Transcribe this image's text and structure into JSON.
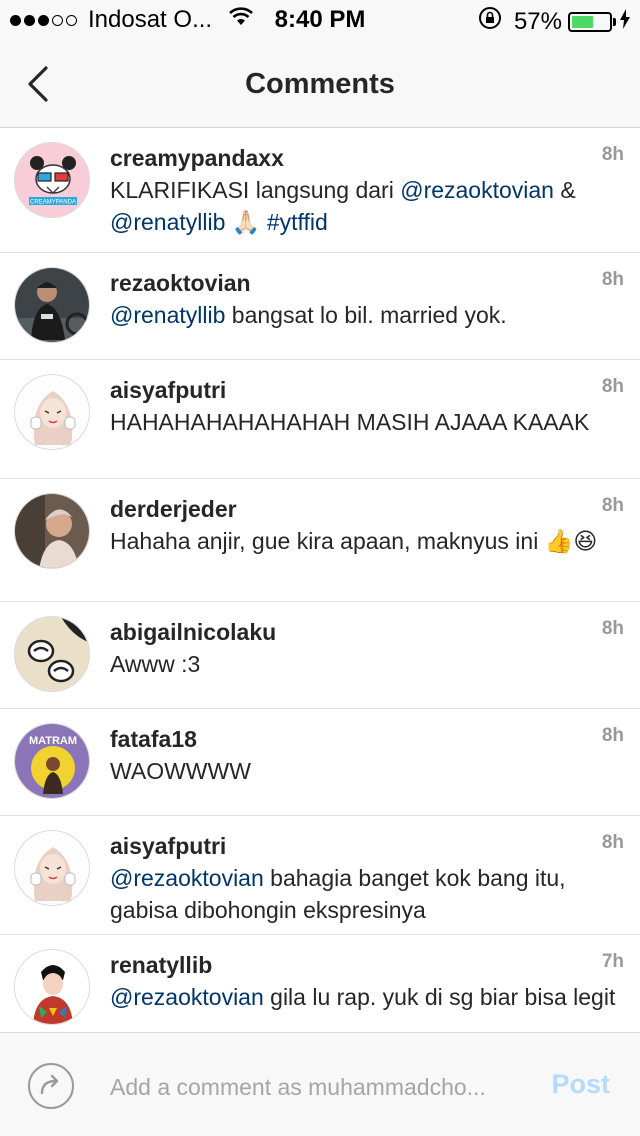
{
  "status_bar": {
    "carrier": "Indosat O...",
    "time": "8:40 PM",
    "battery_percent": "57%",
    "battery_level": 0.57,
    "signal_bars": 3,
    "signal_total": 5
  },
  "header": {
    "title": "Comments",
    "back_icon": "chevron-left-icon"
  },
  "comments": [
    {
      "username": "creamypandaxx",
      "time": "8h",
      "parts": [
        [
          "KLARIFIKASI langsung dari ",
          "text"
        ],
        [
          "@rezaoktovian",
          "mention"
        ],
        [
          " & ",
          "text"
        ],
        [
          "@renatyllib",
          "mention"
        ],
        [
          " 🙏🏻 ",
          "text"
        ],
        [
          "#ytffid",
          "mention"
        ]
      ]
    },
    {
      "username": "rezaoktovian",
      "time": "8h",
      "parts": [
        [
          "@renatyllib",
          "mention"
        ],
        [
          " bangsat lo bil. married yok.",
          "text"
        ]
      ]
    },
    {
      "username": "aisyafputri",
      "time": "8h",
      "parts": [
        [
          "HAHAHAHAHAHAHAH MASIH AJAAA KAAAK",
          "text"
        ]
      ]
    },
    {
      "username": "derderjeder",
      "time": "8h",
      "parts": [
        [
          "Hahaha anjir, gue kira apaan, maknyus ini 👍😆",
          "text"
        ]
      ]
    },
    {
      "username": "abigailnicolaku",
      "time": "8h",
      "parts": [
        [
          "Awww :3",
          "text"
        ]
      ]
    },
    {
      "username": "fatafa18",
      "time": "8h",
      "parts": [
        [
          "WAOWWWW",
          "text"
        ]
      ]
    },
    {
      "username": "aisyafputri",
      "time": "8h",
      "parts": [
        [
          "@rezaoktovian",
          "mention"
        ],
        [
          " bahagia banget kok bang itu, gabisa dibohongin ekspresinya",
          "text"
        ]
      ]
    },
    {
      "username": "renatyllib",
      "time": "7h",
      "parts": [
        [
          "@rezaoktovian",
          "mention"
        ],
        [
          " gila lu rap. yuk di sg biar bisa legit",
          "text"
        ]
      ]
    }
  ],
  "avatar_labels": {
    "creamypandaxx": "CREAMYPANDA",
    "fatafa18": "MATRAM"
  },
  "composer": {
    "placeholder": "Add a comment as muhammadcho...",
    "post_label": "Post",
    "share_icon": "share-arrow-icon"
  },
  "colors": {
    "mention": "#003569",
    "timestamp": "#999999",
    "post_disabled": "#b3dbff",
    "battery": "#4cd964"
  }
}
